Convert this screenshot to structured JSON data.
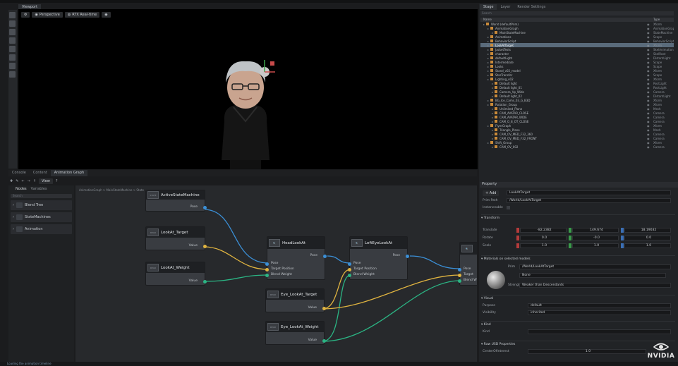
{
  "viewport": {
    "tab": "Viewport",
    "camera": "Perspective",
    "renderer": "RTX Real-time"
  },
  "bottom_tabs": [
    "Console",
    "Content",
    "Animation Graph"
  ],
  "graph_toolbar": {
    "view_label": "View"
  },
  "nodes_library": {
    "tabs": [
      "Nodes",
      "Variables"
    ],
    "search_placeholder": "Search",
    "items": [
      {
        "label": "Blend Tree",
        "icon": "blend-tree-icon"
      },
      {
        "label": "StateMachines",
        "icon": "state-machine-icon"
      },
      {
        "label": "Animation",
        "icon": "animation-icon"
      }
    ]
  },
  "graph": {
    "breadcrumb": "AnimationGraph > MainStateMachine > State",
    "nodes": {
      "active_sm": {
        "title": "ActiveStateMachine",
        "icon_text": "STATE",
        "pin": "Pose"
      },
      "lookat_target": {
        "title": "LookAt_Target",
        "icon_text": "READ",
        "pin": "Value"
      },
      "lookat_weight": {
        "title": "LookAt_Weight",
        "icon_text": "READ",
        "pin": "Value"
      },
      "head_lookat": {
        "title": "HeadLookAt",
        "pins": [
          "Pose",
          "Target Position",
          "Blend Weight"
        ],
        "out": "Pose"
      },
      "lefteye_lookat": {
        "title": "LeftEyeLookAt",
        "pins": [
          "Pose",
          "Target Position",
          "Blend Weight"
        ],
        "out": "Pose"
      },
      "eye_target": {
        "title": "Eye_LookAt_Target",
        "icon_text": "READ",
        "pin": "Value"
      },
      "eye_weight": {
        "title": "Eye_LookAt_Weight",
        "icon_text": "READ",
        "pin": "Value"
      },
      "right_node": {
        "pins": [
          "Pose",
          "Target",
          "Blend W"
        ]
      }
    }
  },
  "stage": {
    "tabs": [
      "Stage",
      "Layer",
      "Render Settings"
    ],
    "search_placeholder": "Search",
    "columns": {
      "name": "Name",
      "type": "Type"
    },
    "rows": [
      {
        "name": "World (defaultPrim)",
        "type": "Xform",
        "indent": 0
      },
      {
        "name": "AnimationGraph",
        "type": "AnimationGraph",
        "indent": 1
      },
      {
        "name": "MainStateMachine",
        "type": "StateMachine",
        "indent": 2
      },
      {
        "name": "Animations",
        "type": "Scope",
        "indent": 1
      },
      {
        "name": "BehaviorScript",
        "type": "BehaviorScript",
        "indent": 1
      },
      {
        "name": "LookAtTarget",
        "type": "Xform",
        "indent": 1,
        "selected": true
      },
      {
        "name": "JacketTests",
        "type": "SkelAnimation",
        "indent": 1
      },
      {
        "name": "character",
        "type": "SkelRoot",
        "indent": 1
      },
      {
        "name": "defaultLight",
        "type": "DistantLight",
        "indent": 1
      },
      {
        "name": "Intermediate",
        "type": "Scope",
        "indent": 1
      },
      {
        "name": "Looks",
        "type": "Scope",
        "indent": 1
      },
      {
        "name": "Stand_v02_model",
        "type": "Xform",
        "indent": 1
      },
      {
        "name": "StarTransfer",
        "type": "Scope",
        "indent": 1
      },
      {
        "name": "Lighting_v02",
        "type": "Xform",
        "indent": 1
      },
      {
        "name": "Default light",
        "type": "RectLight",
        "indent": 2
      },
      {
        "name": "Default light_01",
        "type": "RectLight",
        "indent": 2
      },
      {
        "name": "Camera_Vp_Wide",
        "type": "Camera",
        "indent": 2
      },
      {
        "name": "Default light_02",
        "type": "DistantLight",
        "indent": 2
      },
      {
        "name": "BG_Ice_Cams_03_G_B3D",
        "type": "Xform",
        "indent": 1
      },
      {
        "name": "Rotation_Group",
        "type": "Xform",
        "indent": 1
      },
      {
        "name": "Unlimited_Plane",
        "type": "Mesh",
        "indent": 2
      },
      {
        "name": "CAM_AVATAR_CLOSE",
        "type": "Camera",
        "indent": 2
      },
      {
        "name": "CAM_AVATAR_WIDE",
        "type": "Camera",
        "indent": 2
      },
      {
        "name": "CAM_O_8_OT_CLOSE",
        "type": "Camera",
        "indent": 2
      },
      {
        "name": "FlyerGraph",
        "type": "Xform",
        "indent": 1
      },
      {
        "name": "Triangle_Plane",
        "type": "Mesh",
        "indent": 2
      },
      {
        "name": "CAM_OV_MED_F32_360",
        "type": "Camera",
        "indent": 2
      },
      {
        "name": "CAM_OV_MED_F32_FRONT",
        "type": "Camera",
        "indent": 2
      },
      {
        "name": "Shift_Group",
        "type": "Xform",
        "indent": 1
      },
      {
        "name": "CAM_OV_002",
        "type": "Camera",
        "indent": 2
      }
    ]
  },
  "properties": {
    "tab": "Property",
    "add_label": "+ Add",
    "name_value": "LookAtTarget",
    "prim_path_label": "Prim Path",
    "prim_path_value": "/World/LookAtTarget",
    "instanceable_label": "Instanceable",
    "transform_section": "Transform",
    "translate_label": "Translate",
    "translate": [
      "-82.2382",
      "149.674",
      "18.19032"
    ],
    "rotate_label": "Rotate",
    "rotate": [
      "0.0",
      "-0.0",
      "0.0"
    ],
    "scale_label": "Scale",
    "scale": [
      "1.0",
      "1.0",
      "1.0"
    ],
    "materials_section": "Materials on selected models",
    "prim_label": "Prim",
    "prim_value": "/World/LookAtTarget",
    "material_value": "None",
    "strength_label": "Strength",
    "strength_value": "Weaker than Descendants",
    "visual_section": "Visual",
    "purpose_label": "Purpose",
    "purpose_value": "default",
    "visibility_label": "Visibility",
    "visibility_value": "inherited",
    "kind_section": "Kind",
    "kind_label": "Kind",
    "kind_value": "",
    "raw_section": "Raw USD Properties",
    "coi_label": "CenterOfInterest",
    "coi_value": "1.0"
  },
  "status": {
    "text": "Loading the animation timeline"
  },
  "brand": {
    "logo_text": "NVIDIA"
  },
  "colors": {
    "pose_pin": "#3b8fd6",
    "float_pin": "#2bb584",
    "vector_pin": "#e0b440",
    "selection": "#5a6b7b"
  }
}
